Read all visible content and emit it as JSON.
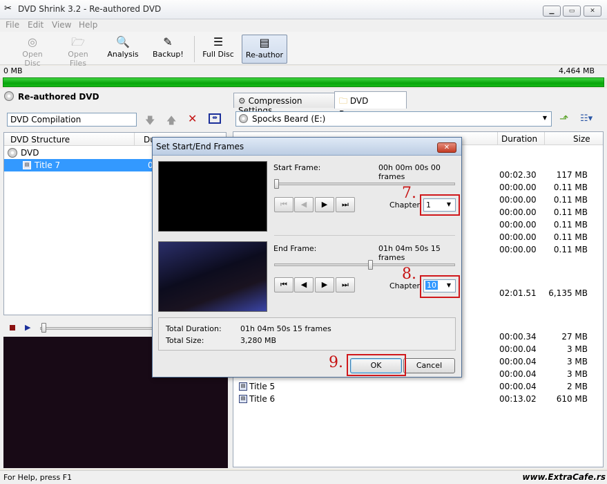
{
  "window": {
    "title": "DVD Shrink 3.2 - Re-authored DVD",
    "minimize": "▁",
    "restore": "▭",
    "close": "✕"
  },
  "menu": [
    "File",
    "Edit",
    "View",
    "Help"
  ],
  "toolbar": {
    "open_disc": "Open Disc",
    "open_files": "Open Files",
    "analysis": "Analysis",
    "backup": "Backup!",
    "full_disc": "Full Disc",
    "re_author": "Re-author"
  },
  "sizes": {
    "left": "0 MB",
    "right": "4,464 MB"
  },
  "progress_fraction": 1.0,
  "left_panel": {
    "title": "Re-authored DVD",
    "compilation_name": "DVD Compilation",
    "columns": [
      "DVD Structure",
      "Du"
    ],
    "tree": [
      {
        "label": "DVD"
      },
      {
        "label": "Title 7",
        "value": "0"
      }
    ]
  },
  "right_panel": {
    "tabs": [
      "Compression Settings",
      "DVD Browser"
    ],
    "drive": "Spocks Beard (E:)",
    "columns": [
      "Duration",
      "Size"
    ],
    "rows": [
      {
        "duration": "00:02.30",
        "size": "117 MB"
      },
      {
        "duration": "00:00.00",
        "size": "0.11 MB"
      },
      {
        "duration": "00:00.00",
        "size": "0.11 MB"
      },
      {
        "duration": "00:00.00",
        "size": "0.11 MB"
      },
      {
        "duration": "00:00.00",
        "size": "0.11 MB"
      },
      {
        "duration": "00:00.00",
        "size": "0.11 MB"
      },
      {
        "duration": "00:00.00",
        "size": "0.11 MB"
      },
      {
        "duration": "02:01.51",
        "size": "6,135 MB"
      },
      {
        "duration": "00:00.34",
        "size": "27 MB"
      },
      {
        "duration": "00:00.04",
        "size": "3 MB"
      },
      {
        "duration": "00:00.04",
        "size": "3 MB"
      },
      {
        "duration": "00:00.04",
        "size": "3 MB"
      },
      {
        "name": "Title 5",
        "duration": "00:00.04",
        "size": "2 MB"
      },
      {
        "name": "Title 6",
        "duration": "00:13.02",
        "size": "610 MB"
      }
    ]
  },
  "dialog": {
    "title": "Set Start/End Frames",
    "start_label": "Start Frame:",
    "start_value": "00h 00m 00s 00 frames",
    "end_label": "End Frame:",
    "end_value": "01h 04m 50s 15 frames",
    "chapter_label": "Chapter",
    "start_chapter": "1",
    "end_chapter": "10",
    "total_duration_label": "Total Duration:",
    "total_duration_value": "01h 04m 50s 15 frames",
    "total_size_label": "Total Size:",
    "total_size_value": "3,280 MB",
    "ok": "OK",
    "cancel": "Cancel",
    "start_slider_fraction": 0.0,
    "end_slider_fraction": 0.53
  },
  "annotations": {
    "step7": "7.",
    "step8": "8.",
    "step9": "9."
  },
  "status": "For Help, press F1",
  "watermark": "www.ExtraCafe.rs",
  "colors": {
    "progress": "#16b816",
    "selection": "#3399ff",
    "highlight_box": "#d0171b"
  }
}
